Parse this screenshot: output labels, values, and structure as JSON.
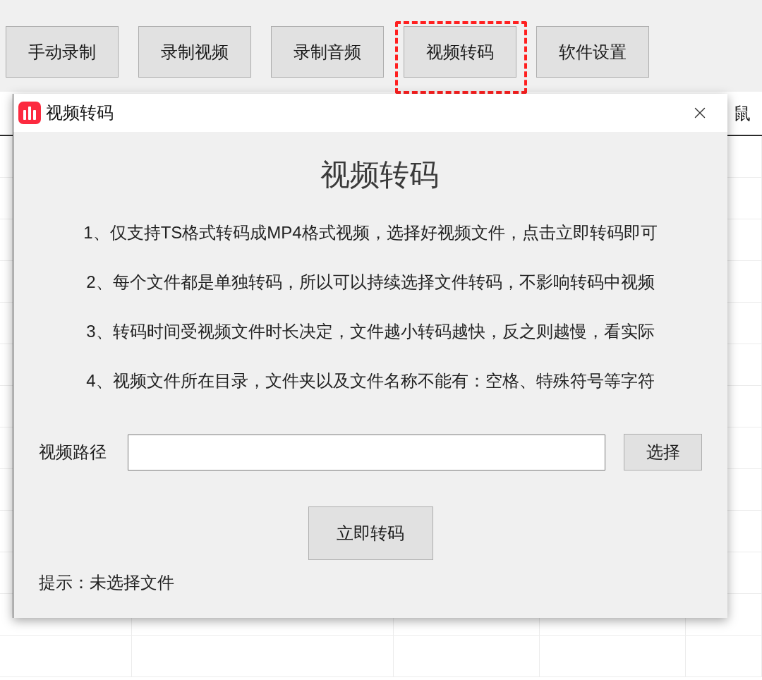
{
  "toolbar": {
    "buttons": [
      {
        "label": "手动录制",
        "highlighted": false
      },
      {
        "label": "录制视频",
        "highlighted": false
      },
      {
        "label": "录制音频",
        "highlighted": false
      },
      {
        "label": "视频转码",
        "highlighted": true
      },
      {
        "label": "软件设置",
        "highlighted": false
      }
    ]
  },
  "table": {
    "header_cells": [
      "鼠"
    ]
  },
  "dialog": {
    "title": "视频转码",
    "heading": "视频转码",
    "instructions": [
      "1、仅支持TS格式转码成MP4格式视频，选择好视频文件，点击立即转码即可",
      "2、每个文件都是单独转码，所以可以持续选择文件转码，不影响转码中视频",
      "3、转码时间受视频文件时长决定，文件越小转码越快，反之则越慢，看实际",
      "4、视频文件所在目录，文件夹以及文件名称不能有：空格、特殊符号等字符"
    ],
    "path_field": {
      "label": "视频路径"
    },
    "browse_button": "选择",
    "convert_button": "立即转码",
    "status": "提示：未选择文件"
  }
}
